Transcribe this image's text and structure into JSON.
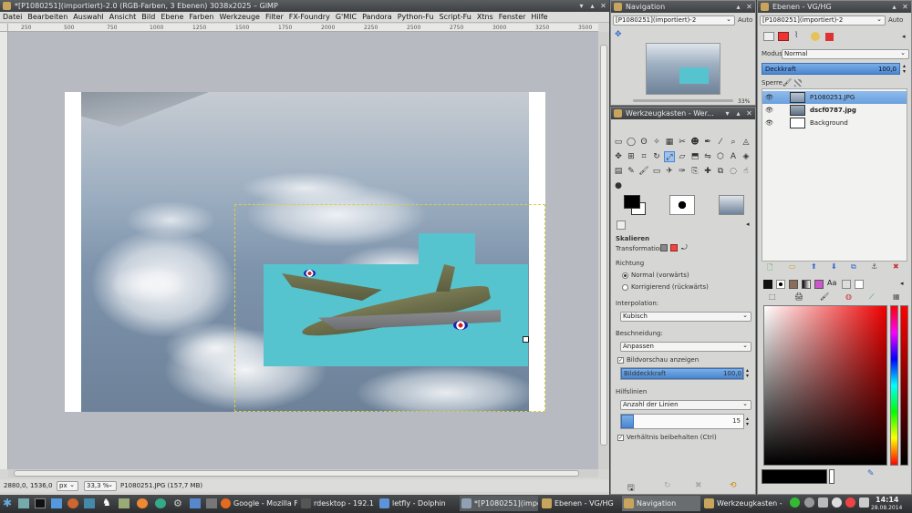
{
  "gimp": {
    "title": "*[P1080251](importiert)-2.0 (RGB-Farben, 3 Ebenen) 3038x2025 – GIMP",
    "menu": [
      "Datei",
      "Bearbeiten",
      "Auswahl",
      "Ansicht",
      "Bild",
      "Ebene",
      "Farben",
      "Werkzeuge",
      "Filter",
      "FX-Foundry",
      "G'MIC",
      "Pandora",
      "Python-Fu",
      "Script-Fu",
      "Xtns",
      "Fenster",
      "Hilfe"
    ],
    "ruler_ticks": [
      "250",
      "500",
      "750",
      "1000",
      "1250",
      "1500",
      "1750",
      "2000",
      "2250",
      "2500",
      "2750",
      "3000",
      "3250",
      "3500"
    ],
    "status": {
      "coords": "2880,0, 1536,0",
      "unit": "px",
      "zoom": "33,3 %",
      "file_info": "P1080251.JPG (157,7 MB)"
    }
  },
  "navigation": {
    "title": "Navigation",
    "combo": "[P1080251](importiert)-2",
    "auto_label": "Auto",
    "zoom_pct": "33%"
  },
  "toolbox": {
    "title": "Werkzeugkasten - Wer...",
    "tool_icons": [
      "rect-select-icon",
      "ellipse-select-icon",
      "lasso-icon",
      "fuzzy-select-icon",
      "color-select-icon",
      "scissors-icon",
      "foreground-select-icon",
      "paths-icon",
      "color-picker-icon",
      "zoom-icon",
      "measure-icon",
      "move-icon",
      "align-icon",
      "crop-icon",
      "rotate-icon",
      "scale-icon",
      "shear-icon",
      "perspective-icon",
      "flip-icon",
      "cage-icon",
      "text-icon",
      "bucket-fill-icon",
      "blend-icon",
      "pencil-icon",
      "paintbrush-icon",
      "eraser-icon",
      "airbrush-icon",
      "ink-icon",
      "clone-icon",
      "heal-icon",
      "perspective-clone-icon",
      "blur-icon",
      "smudge-icon",
      "dodge-icon"
    ],
    "options": {
      "section": "Skalieren",
      "transformation_label": "Transformation:",
      "richtung_label": "Richtung",
      "radio_normal": "Normal (vorwärts)",
      "radio_korrigierend": "Korrigierend (rückwärts)",
      "interpolation_label": "Interpolation:",
      "interpolation_value": "Kubisch",
      "beschneidung_label": "Beschneidung:",
      "beschneidung_value": "Anpassen",
      "preview_label": "Bildvorschau anzeigen",
      "opacity_label": "Bilddeckkraft",
      "opacity_value": "100,0",
      "opacity_fraction": 1.0,
      "hilfslinien_label": "Hilfslinien",
      "hilfslinien_value": "Anzahl der Linien",
      "lines_value": "15",
      "ratio_label": "Verhältnis beibehalten (Ctrl)"
    }
  },
  "layers": {
    "title": "Ebenen - VG/HG",
    "combo": "[P1080251](importiert)-2",
    "auto_label": "Auto",
    "modus_label": "Modus",
    "modus_value": "Normal",
    "deckkraft_label": "Deckkraft",
    "deckkraft_value": "100,0",
    "sperre_label": "Sperre",
    "items": [
      {
        "name": "P1080251.JPG",
        "selected": true
      },
      {
        "name": "dscf0787.jpg",
        "selected": false
      },
      {
        "name": "Background",
        "selected": false
      }
    ]
  },
  "colors": {
    "fg": "#000000",
    "bg": "#ffffff",
    "accent": "#4a86d0"
  },
  "taskbar": {
    "tasks": [
      "Google - Mozilla Fi...",
      "rdesktop - 192.168...",
      "letfly - Dolphin",
      "*[P1080251](impo...",
      "Ebenen - VG/HG",
      "Navigation",
      "Werkzeugkasten - ..."
    ],
    "time": "14:14",
    "date": "28.08.2014"
  }
}
